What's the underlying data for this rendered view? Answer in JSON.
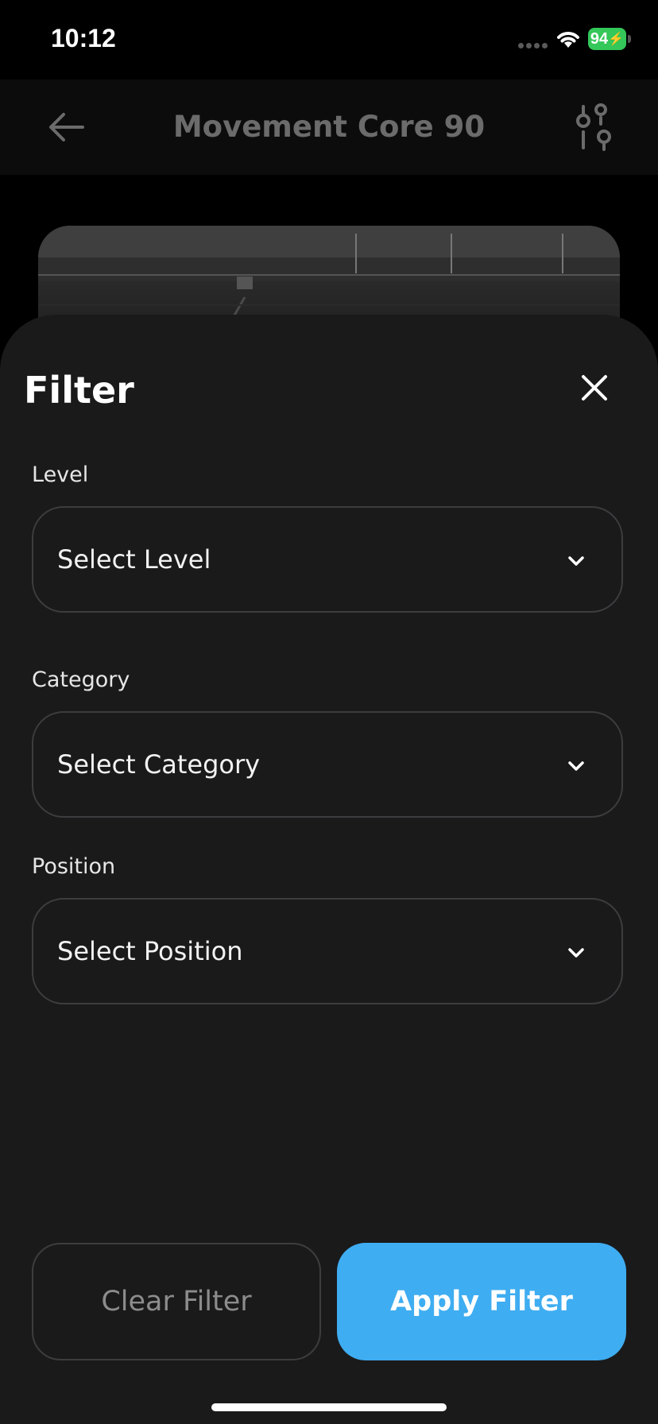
{
  "status_bar": {
    "time": "10:12",
    "battery": "94"
  },
  "nav": {
    "title": "Movement Core 90",
    "back_icon": "arrow-left-icon",
    "filter_icon": "sliders-icon"
  },
  "sheet": {
    "title": "Filter",
    "close_icon": "close-icon",
    "fields": [
      {
        "label": "Level",
        "placeholder": "Select Level"
      },
      {
        "label": "Category",
        "placeholder": "Select Category"
      },
      {
        "label": "Position",
        "placeholder": "Select Position"
      }
    ],
    "clear_label": "Clear Filter",
    "apply_label": "Apply Filter"
  },
  "colors": {
    "accent": "#3fadf1",
    "battery": "#34c759",
    "sheet_bg": "#1a1a1b"
  }
}
